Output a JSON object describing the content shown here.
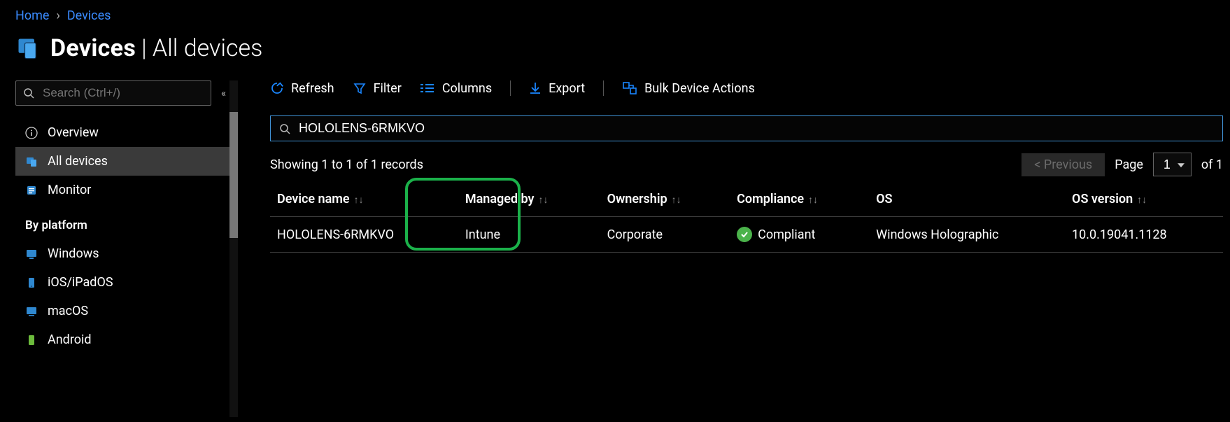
{
  "breadcrumb": {
    "home": "Home",
    "devices": "Devices"
  },
  "title": {
    "bold": "Devices",
    "thin": "| All devices"
  },
  "sidebar": {
    "search_placeholder": "Search (Ctrl+/)",
    "items": [
      {
        "label": "Overview",
        "icon": "info"
      },
      {
        "label": "All devices",
        "icon": "devices",
        "selected": true
      },
      {
        "label": "Monitor",
        "icon": "monitor"
      }
    ],
    "platform_heading": "By platform",
    "platform_items": [
      {
        "label": "Windows",
        "icon": "windows"
      },
      {
        "label": "iOS/iPadOS",
        "icon": "ios"
      },
      {
        "label": "macOS",
        "icon": "macos"
      },
      {
        "label": "Android",
        "icon": "android"
      }
    ]
  },
  "toolbar": {
    "refresh": "Refresh",
    "filter": "Filter",
    "columns": "Columns",
    "export": "Export",
    "bulk": "Bulk Device Actions"
  },
  "filter_value": "HOLOLENS-6RMKVO",
  "status_text": "Showing 1 to 1 of 1 records",
  "pager": {
    "previous": "< Previous",
    "label": "Page",
    "page": "1",
    "of": "of 1"
  },
  "table": {
    "columns": [
      "Device name",
      "Managed by",
      "Ownership",
      "Compliance",
      "OS",
      "OS version"
    ],
    "rows": [
      {
        "device_name": "HOLOLENS-6RMKVO",
        "managed_by": "Intune",
        "ownership": "Corporate",
        "compliance": "Compliant",
        "os": "Windows Holographic",
        "os_version": "10.0.19041.1128"
      }
    ]
  },
  "highlight_column": "Managed by"
}
